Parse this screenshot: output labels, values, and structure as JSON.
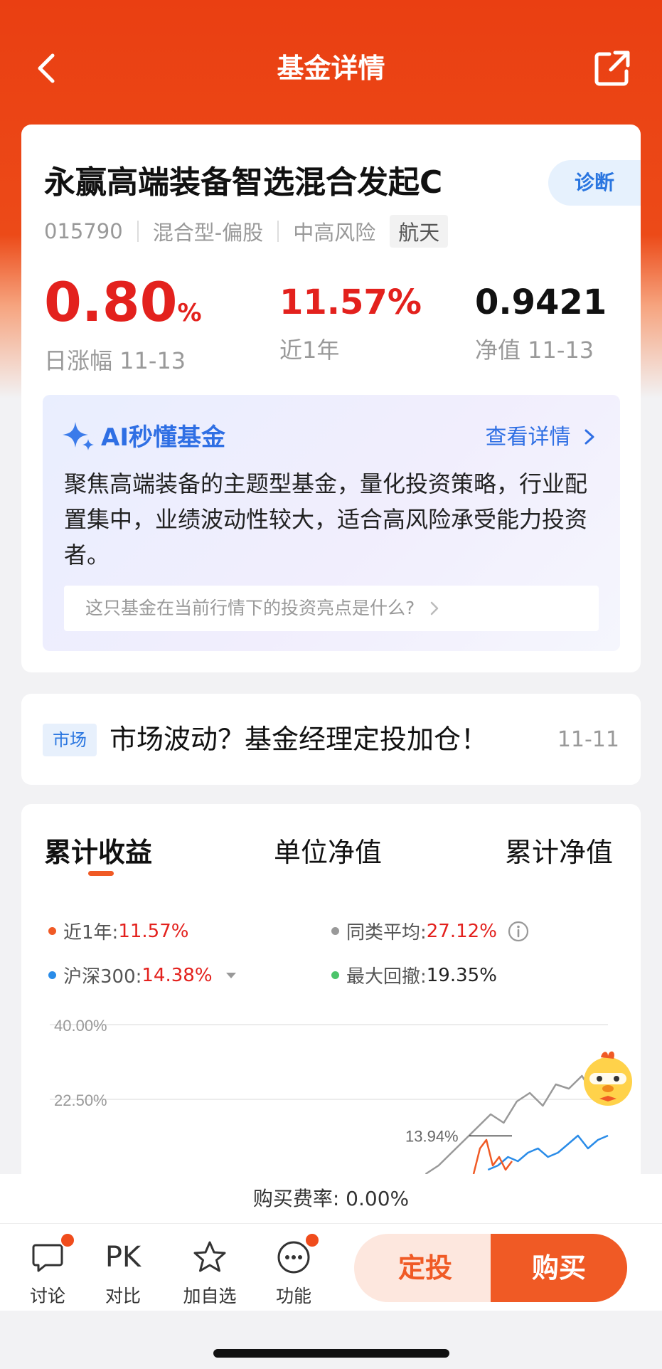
{
  "nav": {
    "title": "基金详情"
  },
  "fund": {
    "name": "永赢高端装备智选混合发起C",
    "diagnose_label": "诊断",
    "code": "015790",
    "type": "混合型-偏股",
    "risk": "中高风险",
    "theme_tag": "航天",
    "daily_change_value": "0.80",
    "daily_change_unit": "%",
    "daily_change_label": "日涨幅 11-13",
    "year_return": "11.57%",
    "year_return_label": "近1年",
    "nav_value": "0.9421",
    "nav_label": "净值 11-13"
  },
  "ai": {
    "title": "AI秒懂基金",
    "more_label": "查看详情",
    "summary": "聚焦高端装备的主题型基金，量化投资策略，行业配置集中，业绩波动性较大，适合高风险承受能力投资者。",
    "question": "这只基金在当前行情下的投资亮点是什么?"
  },
  "news": {
    "tag": "市场",
    "text": "市场波动？基金经理定投加仓！",
    "date": "11-11"
  },
  "chart_tabs": [
    "累计收益",
    "单位净值",
    "累计净值"
  ],
  "legend": {
    "fund_label": "近1年:",
    "fund_value": "11.57%",
    "peer_label": "同类平均:",
    "peer_value": "27.12%",
    "index_label": "沪深300:",
    "index_value": "14.38%",
    "drawdown_label": "最大回撤:",
    "drawdown_value": "19.35%"
  },
  "colors": {
    "fund": "#f05a25",
    "peer": "#999999",
    "index": "#2a8ce8",
    "drawdown": "#4cc46a",
    "accent": "#ea3f12"
  },
  "chart_data": {
    "type": "line",
    "y_ticks": [
      "40.00%",
      "22.50%"
    ],
    "ylim": [
      5,
      40
    ],
    "annotation": "13.94%",
    "series": [
      {
        "name": "同类平均",
        "values": [
          5,
          7,
          10,
          13,
          16,
          19,
          17,
          22,
          24,
          21,
          26,
          25,
          28,
          23,
          27
        ]
      },
      {
        "name": "沪深300",
        "values": [
          6,
          7,
          9,
          8,
          10,
          11,
          9,
          10,
          12,
          14,
          11,
          13,
          14
        ]
      },
      {
        "name": "近1年",
        "values": [
          5,
          11,
          13,
          7,
          9,
          6,
          8
        ]
      }
    ]
  },
  "fee": {
    "text": "购买费率: 0.00%"
  },
  "toolbar": {
    "discuss": "讨论",
    "pk_icon": "PK",
    "compare": "对比",
    "watch": "加自选",
    "functions": "功能",
    "plan_label": "定投",
    "buy_label": "购买"
  }
}
